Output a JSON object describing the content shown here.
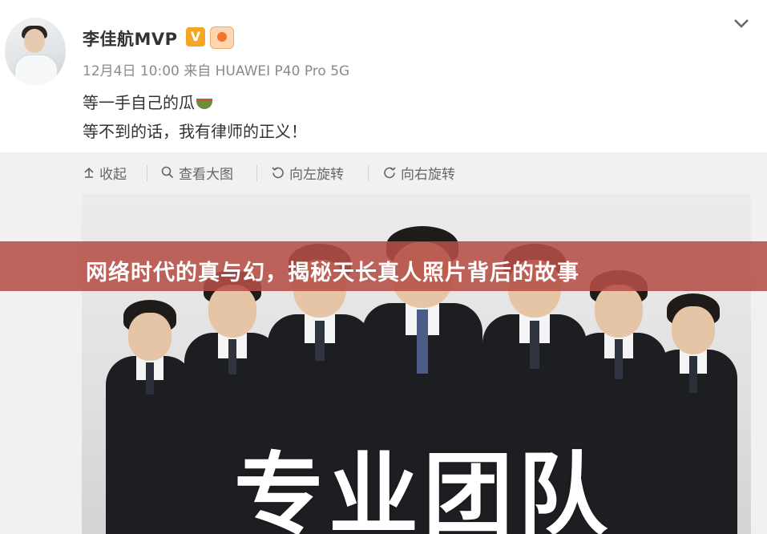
{
  "post": {
    "username": "李佳航MVP",
    "verified_badge": "V",
    "meta": "12月4日 10:00 来自 HUAWEI P40 Pro 5G",
    "line1": "等一手自己的瓜",
    "line2": "等不到的话，我有律师的正义！"
  },
  "toolbar": {
    "collapse_label": "收起",
    "view_large_label": "查看大图",
    "rotate_left_label": "向左旋转",
    "rotate_right_label": "向右旋转"
  },
  "photo": {
    "overlay_text": "专业团队"
  },
  "banner": {
    "title": "网络时代的真与幻，揭秘天长真人照片背后的故事"
  },
  "colors": {
    "banner": "#b64e46",
    "badge_v": "#f5a623",
    "meta_text": "#8a8a8a"
  }
}
